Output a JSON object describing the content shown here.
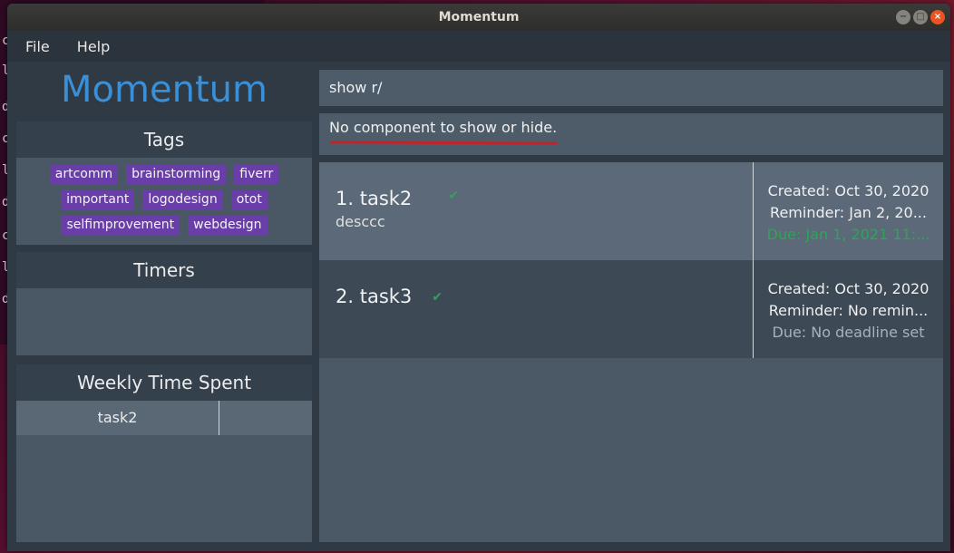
{
  "background_terminal": {
    "lines": [
      "c",
      "l",
      "l",
      "d",
      "c",
      "l",
      "d",
      "c",
      "l",
      "d"
    ]
  },
  "window": {
    "title": "Momentum",
    "controls": {
      "minimize": "−",
      "maximize": "□",
      "close": "×"
    }
  },
  "menu": {
    "file": "File",
    "help": "Help"
  },
  "sidebar": {
    "app_title": "Momentum",
    "tags": {
      "heading": "Tags",
      "items": [
        "artcomm",
        "brainstorming",
        "fiverr",
        "important",
        "logodesign",
        "otot",
        "selfimprovement",
        "webdesign"
      ]
    },
    "timers": {
      "heading": "Timers"
    },
    "weekly": {
      "heading": "Weekly Time Spent",
      "rows": [
        {
          "name": "task2",
          "time": ""
        }
      ]
    }
  },
  "command": {
    "value": "show r/"
  },
  "result": {
    "message": "No component to show or hide."
  },
  "tasks": [
    {
      "title": "1. task2",
      "description": "desccc",
      "created": "Created: Oct 30, 2020",
      "reminder": "Reminder: Jan 2, 20...",
      "due": "Due: Jan 1, 2021 11:..."
    },
    {
      "title": "2. task3",
      "description": "",
      "created": "Created: Oct 30, 2020",
      "reminder": "Reminder: No remin...",
      "due": "Due: No deadline set"
    }
  ],
  "colors": {
    "title_blue": "#3a8fd6",
    "tag_purple": "#6a3ea8",
    "due_green": "#2ea458",
    "underline_red": "#c0242a"
  },
  "icons": {
    "check": "✔"
  }
}
